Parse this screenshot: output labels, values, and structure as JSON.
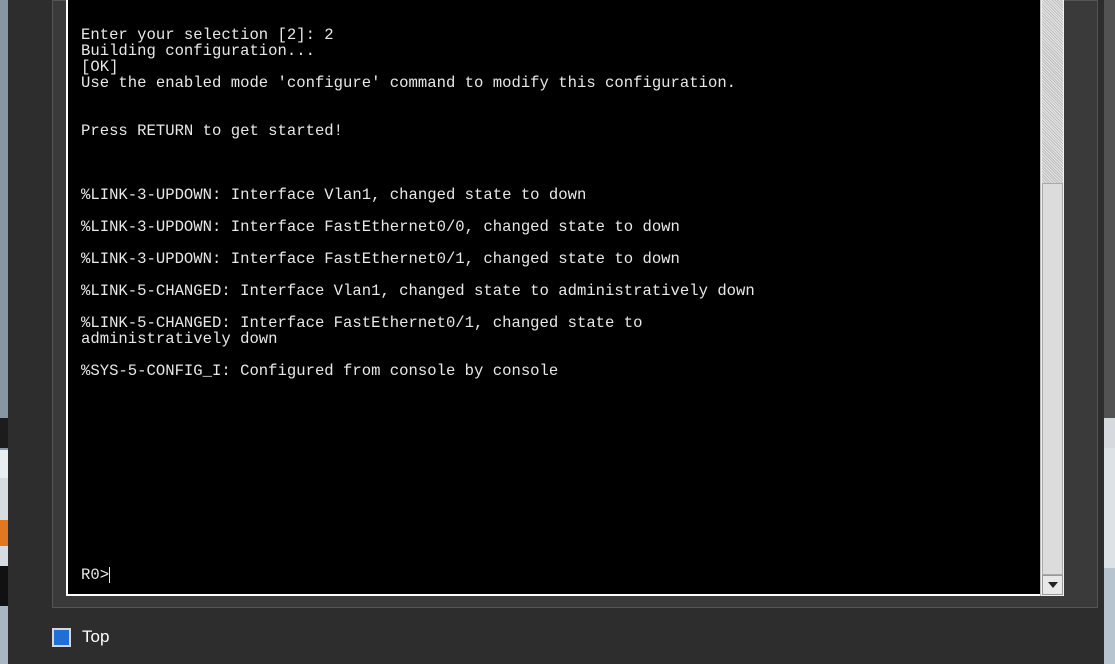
{
  "terminal": {
    "lines": [
      "Enter your selection [2]: 2",
      "Building configuration...",
      "[OK]",
      "Use the enabled mode 'configure' command to modify this configuration.",
      "",
      "",
      "Press RETURN to get started!",
      "",
      "",
      "",
      "%LINK-3-UPDOWN: Interface Vlan1, changed state to down",
      "",
      "%LINK-3-UPDOWN: Interface FastEthernet0/0, changed state to down",
      "",
      "%LINK-3-UPDOWN: Interface FastEthernet0/1, changed state to down",
      "",
      "%LINK-5-CHANGED: Interface Vlan1, changed state to administratively down",
      "",
      "%LINK-5-CHANGED: Interface FastEthernet0/1, changed state to",
      "administratively down",
      "",
      "%SYS-5-CONFIG_I: Configured from console by console"
    ],
    "prompt": "R0>"
  },
  "bottom_bar": {
    "top_checkbox_label": "Top",
    "checkbox_color": "#1f6fd6"
  },
  "colors": {
    "terminal_bg": "#000000",
    "terminal_text": "#e8e8e8",
    "window_bg": "#2d2d2d"
  },
  "icons": {
    "scroll_down": "chevron-down-icon"
  }
}
